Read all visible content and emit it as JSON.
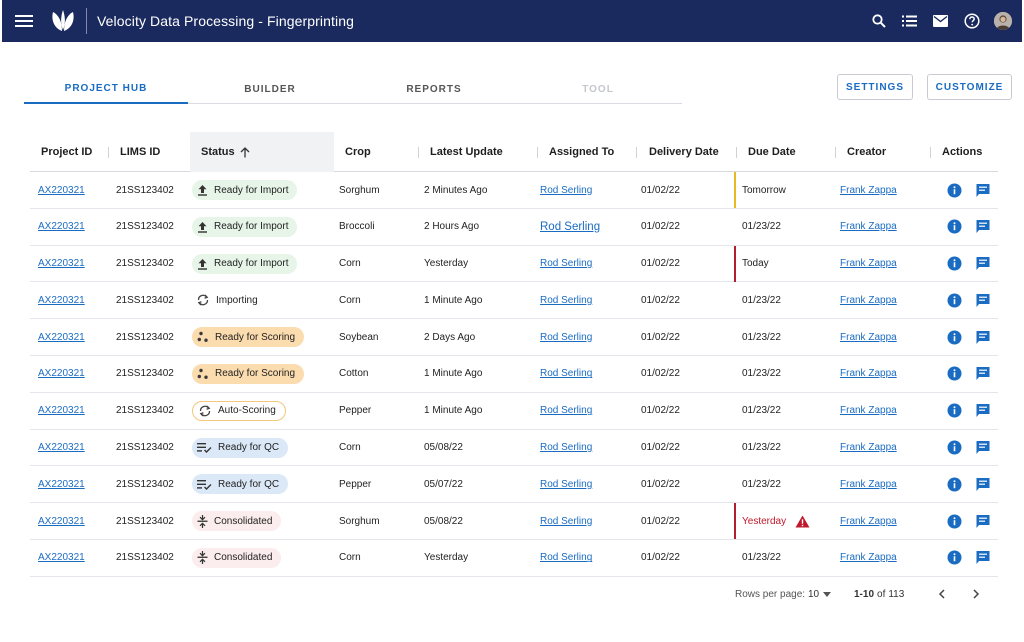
{
  "app": {
    "title": "Velocity Data Processing - Fingerprinting",
    "icons": [
      "menu-icon",
      "leaf-logo",
      "search-icon",
      "list-icon",
      "mail-icon",
      "help-icon",
      "avatar"
    ]
  },
  "tabs": [
    {
      "label": "PROJECT HUB",
      "state": "active"
    },
    {
      "label": "BUILDER",
      "state": "normal"
    },
    {
      "label": "REPORTS",
      "state": "normal"
    },
    {
      "label": "TOOL",
      "state": "disabled"
    }
  ],
  "buttons": {
    "settings": "SETTINGS",
    "customize": "CUSTOMIZE"
  },
  "table": {
    "columns": {
      "project_id": "Project ID",
      "lims_id": "LIMS ID",
      "status": "Status",
      "crop": "Crop",
      "latest_update": "Latest Update",
      "assigned_to": "Assigned To",
      "delivery_date": "Delivery Date",
      "due_date": "Due Date",
      "creator": "Creator",
      "actions": "Actions"
    },
    "sort_icon": "arrow-up-icon",
    "rows": [
      {
        "project_id": "AX220321",
        "lims_id": "21SS123402",
        "status": "Ready for Import",
        "status_type": "import",
        "crop": "Sorghum",
        "latest_update": "2 Minutes Ago",
        "assigned_to": "Rod Serling",
        "delivery_date": "01/02/22",
        "due_date": "Tomorrow",
        "due_flag": "warning",
        "creator": "Frank Zappa"
      },
      {
        "project_id": "AX220321",
        "lims_id": "21SS123402",
        "status": "Ready for Import",
        "status_type": "import",
        "crop": "Broccoli",
        "latest_update": "2 Hours Ago",
        "assigned_to": "Rod Serling",
        "delivery_date": "01/02/22",
        "due_date": "01/23/22",
        "due_flag": "none",
        "creator": "Frank Zappa"
      },
      {
        "project_id": "AX220321",
        "lims_id": "21SS123402",
        "status": "Ready for Import",
        "status_type": "import",
        "crop": "Corn",
        "latest_update": "Yesterday",
        "assigned_to": "Rod Serling",
        "delivery_date": "01/02/22",
        "due_date": "Today",
        "due_flag": "critical",
        "creator": "Frank Zappa"
      },
      {
        "project_id": "AX220321",
        "lims_id": "21SS123402",
        "status": "Importing",
        "status_type": "importing",
        "crop": "Corn",
        "latest_update": "1 Minute Ago",
        "assigned_to": "Rod Serling",
        "delivery_date": "01/02/22",
        "due_date": "01/23/22",
        "due_flag": "none",
        "creator": "Frank Zappa"
      },
      {
        "project_id": "AX220321",
        "lims_id": "21SS123402",
        "status": "Ready for Scoring",
        "status_type": "scoring",
        "crop": "Soybean",
        "latest_update": "2 Days Ago",
        "assigned_to": "Rod Serling",
        "delivery_date": "01/02/22",
        "due_date": "01/23/22",
        "due_flag": "none",
        "creator": "Frank Zappa"
      },
      {
        "project_id": "AX220321",
        "lims_id": "21SS123402",
        "status": "Ready for Scoring",
        "status_type": "scoring",
        "crop": "Cotton",
        "latest_update": "1 Minute Ago",
        "assigned_to": "Rod Serling",
        "delivery_date": "01/02/22",
        "due_date": "01/23/22",
        "due_flag": "none",
        "creator": "Frank Zappa"
      },
      {
        "project_id": "AX220321",
        "lims_id": "21SS123402",
        "status": "Auto-Scoring",
        "status_type": "autoscoring",
        "crop": "Pepper",
        "latest_update": "1 Minute Ago",
        "assigned_to": "Rod Serling",
        "delivery_date": "01/02/22",
        "due_date": "01/23/22",
        "due_flag": "none",
        "creator": "Frank Zappa"
      },
      {
        "project_id": "AX220321",
        "lims_id": "21SS123402",
        "status": "Ready for QC",
        "status_type": "qc",
        "crop": "Corn",
        "latest_update": "05/08/22",
        "assigned_to": "Rod Serling",
        "delivery_date": "01/02/22",
        "due_date": "01/23/22",
        "due_flag": "none",
        "creator": "Frank Zappa"
      },
      {
        "project_id": "AX220321",
        "lims_id": "21SS123402",
        "status": "Ready for QC",
        "status_type": "qc",
        "crop": "Pepper",
        "latest_update": "05/07/22",
        "assigned_to": "Rod Serling",
        "delivery_date": "01/02/22",
        "due_date": "01/23/22",
        "due_flag": "none",
        "creator": "Frank Zappa"
      },
      {
        "project_id": "AX220321",
        "lims_id": "21SS123402",
        "status": "Consolidated",
        "status_type": "consolidated",
        "crop": "Sorghum",
        "latest_update": "05/08/22",
        "assigned_to": "Rod Serling",
        "delivery_date": "01/02/22",
        "due_date": "Yesterday",
        "due_flag": "overdue",
        "creator": "Frank Zappa"
      },
      {
        "project_id": "AX220321",
        "lims_id": "21SS123402",
        "status": "Consolidated",
        "status_type": "consolidated",
        "crop": "Corn",
        "latest_update": "Yesterday",
        "assigned_to": "Rod Serling",
        "delivery_date": "01/02/22",
        "due_date": "01/23/22",
        "due_flag": "none",
        "creator": "Frank Zappa"
      }
    ],
    "row_actions": [
      "info-icon",
      "comment-icon"
    ]
  },
  "pagination": {
    "rows_per_page_label": "Rows per page:",
    "rows_per_page_value": "10",
    "range": "1-10",
    "of_label": "of",
    "total": "113"
  },
  "colors": {
    "app_bar": "#1b2a5e",
    "accent": "#1a6cc2",
    "warning": "#e8b923",
    "critical": "#b0202e",
    "overdue_text": "#c0182b"
  }
}
